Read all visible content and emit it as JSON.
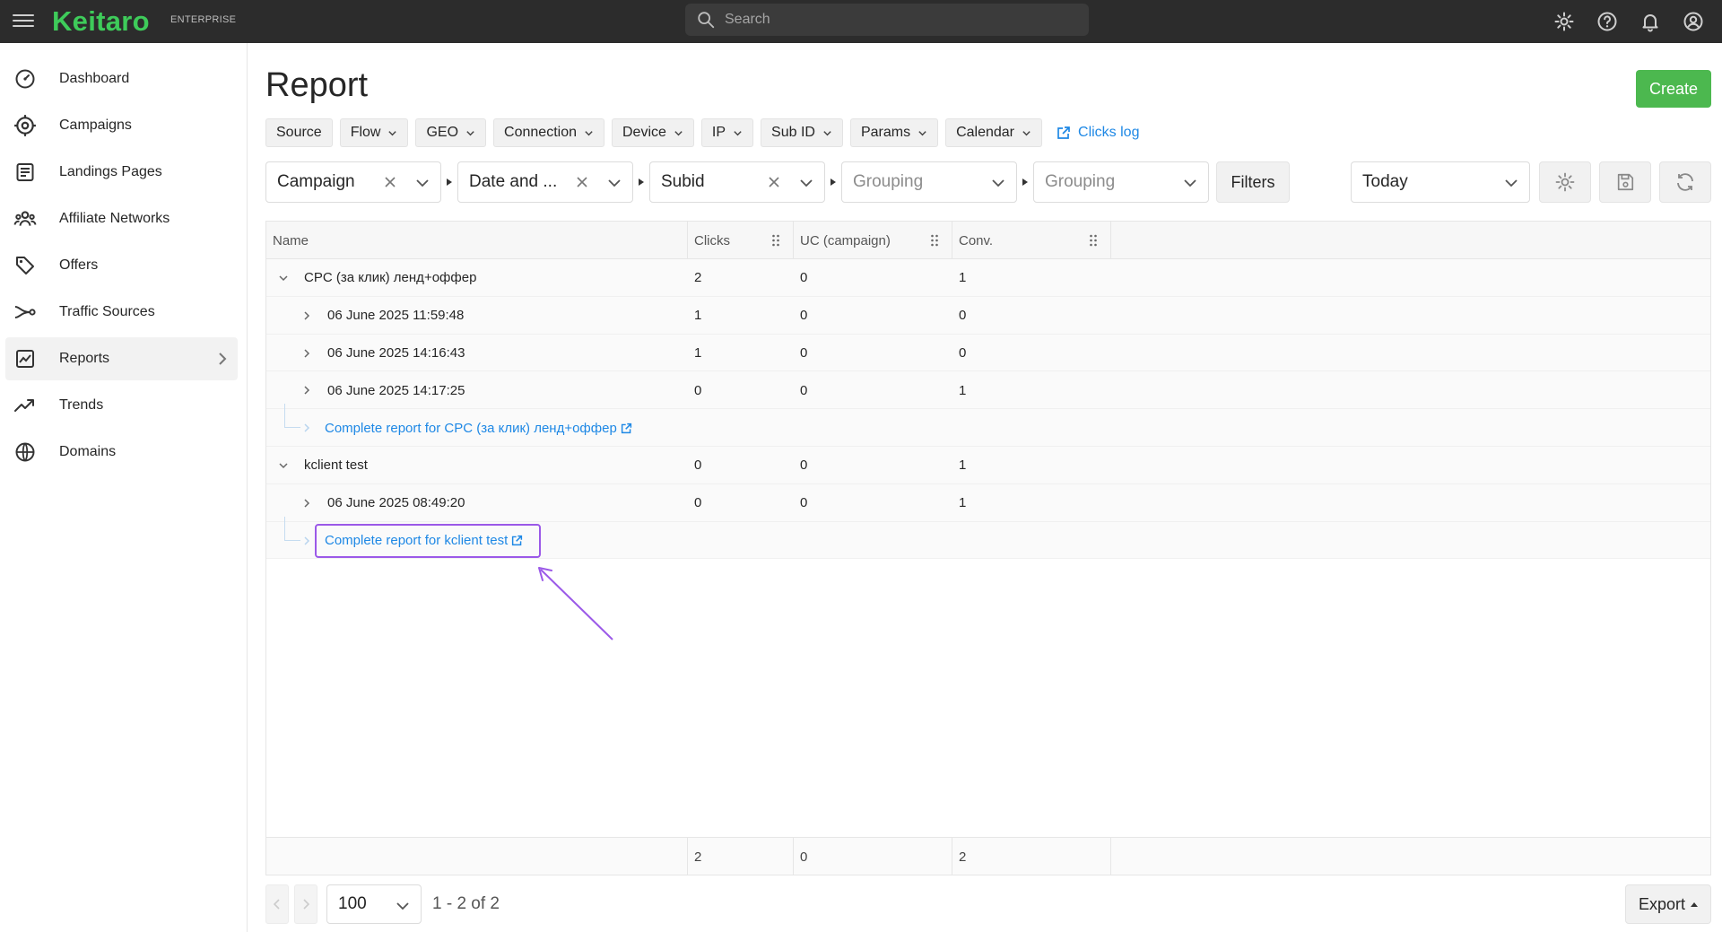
{
  "app": {
    "logo": "Keitaro",
    "edition": "ENTERPRISE"
  },
  "search": {
    "placeholder": "Search"
  },
  "sidebar": {
    "items": [
      {
        "label": "Dashboard",
        "icon": "dashboard-icon"
      },
      {
        "label": "Campaigns",
        "icon": "target-icon"
      },
      {
        "label": "Landings Pages",
        "icon": "landing-page-icon"
      },
      {
        "label": "Affiliate Networks",
        "icon": "people-icon"
      },
      {
        "label": "Offers",
        "icon": "tags-icon"
      },
      {
        "label": "Traffic Sources",
        "icon": "route-icon"
      },
      {
        "label": "Reports",
        "icon": "chart-icon"
      },
      {
        "label": "Trends",
        "icon": "trend-icon"
      },
      {
        "label": "Domains",
        "icon": "globe-icon"
      }
    ]
  },
  "page": {
    "title": "Report",
    "create_label": "Create"
  },
  "chips": [
    "Source",
    "Flow",
    "GEO",
    "Connection",
    "Device",
    "IP",
    "Sub ID",
    "Params",
    "Calendar"
  ],
  "clicks_log": "Clicks log",
  "groupings": [
    "Campaign",
    "Date and ...",
    "Subid",
    "Grouping",
    "Grouping"
  ],
  "filters_label": "Filters",
  "period": "Today",
  "table": {
    "headers": {
      "name": "Name",
      "clicks": "Clicks",
      "uc": "UC (campaign)",
      "conv": "Conv."
    },
    "rows": [
      {
        "name": "CPC (за клик) ленд+оффер",
        "clicks": "2",
        "uc": "0",
        "conv": "1"
      },
      {
        "name": "06 June 2025 11:59:48",
        "clicks": "1",
        "uc": "0",
        "conv": "0"
      },
      {
        "name": "06 June 2025 14:16:43",
        "clicks": "1",
        "uc": "0",
        "conv": "0"
      },
      {
        "name": "06 June 2025 14:17:25",
        "clicks": "0",
        "uc": "0",
        "conv": "1"
      },
      {
        "name": "Complete report for CPC (за клик) ленд+оффер"
      },
      {
        "name": "kclient test",
        "clicks": "0",
        "uc": "0",
        "conv": "1"
      },
      {
        "name": "06 June 2025 08:49:20",
        "clicks": "0",
        "uc": "0",
        "conv": "1"
      },
      {
        "name": "Complete report for kclient test"
      }
    ],
    "totals": {
      "clicks": "2",
      "uc": "0",
      "conv": "2"
    }
  },
  "pagination": {
    "page_size": "100",
    "info": "1 - 2 of 2"
  },
  "export_label": "Export",
  "colors": {
    "topbar": "#2c2c2c",
    "brand": "#3ecb5a",
    "create": "#4cb84f",
    "link": "#1e88e5",
    "highlight": "#9b59e8"
  }
}
